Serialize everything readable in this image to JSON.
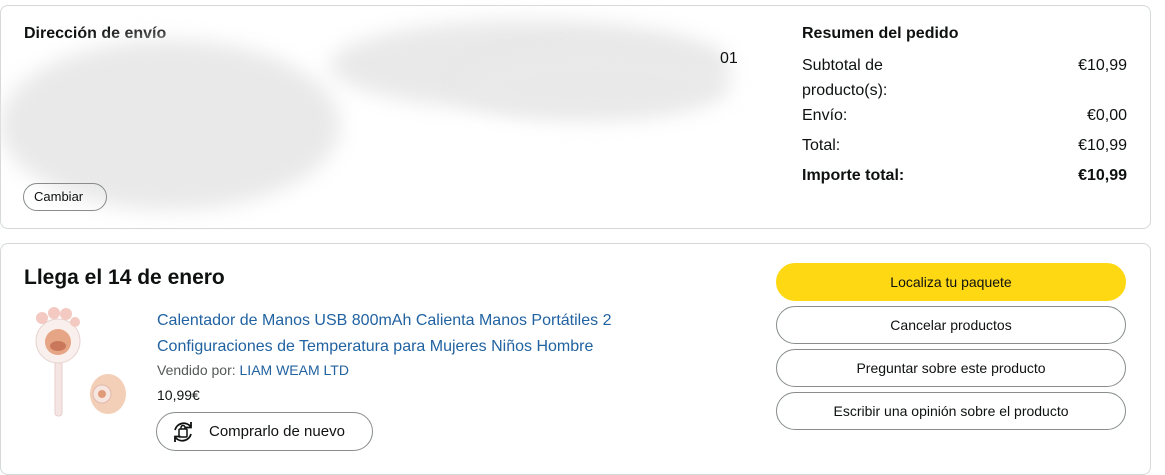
{
  "shipping": {
    "title": "Dirección de envío",
    "address_tail": "01",
    "change_label": "Cambiar"
  },
  "summary": {
    "title": "Resumen del pedido",
    "subtotal_label": "Subtotal de producto(s):",
    "subtotal_value": "€10,99",
    "shipping_label": "Envío:",
    "shipping_value": "€0,00",
    "total_label": "Total:",
    "total_value": "€10,99",
    "grand_label": "Importe total:",
    "grand_value": "€10,99"
  },
  "delivery": {
    "title": "Llega el 14 de enero",
    "product_title": "Calentador de Manos USB 800mAh Calienta Manos Portátiles 2 Configuraciones de Temperatura para Mujeres Niños Hombre",
    "seller_prefix": "Vendido por:",
    "seller_name": "LIAM WEAM LTD",
    "price": "10,99€",
    "rebuy_label": "Comprarlo de nuevo"
  },
  "actions": {
    "track": "Localiza tu paquete",
    "cancel": "Cancelar productos",
    "ask": "Preguntar sobre este producto",
    "review": "Escribir una opinión sobre el producto"
  },
  "colors": {
    "primary_button": "#ffd814",
    "link": "#2162a1",
    "border": "#d5d9d9"
  }
}
